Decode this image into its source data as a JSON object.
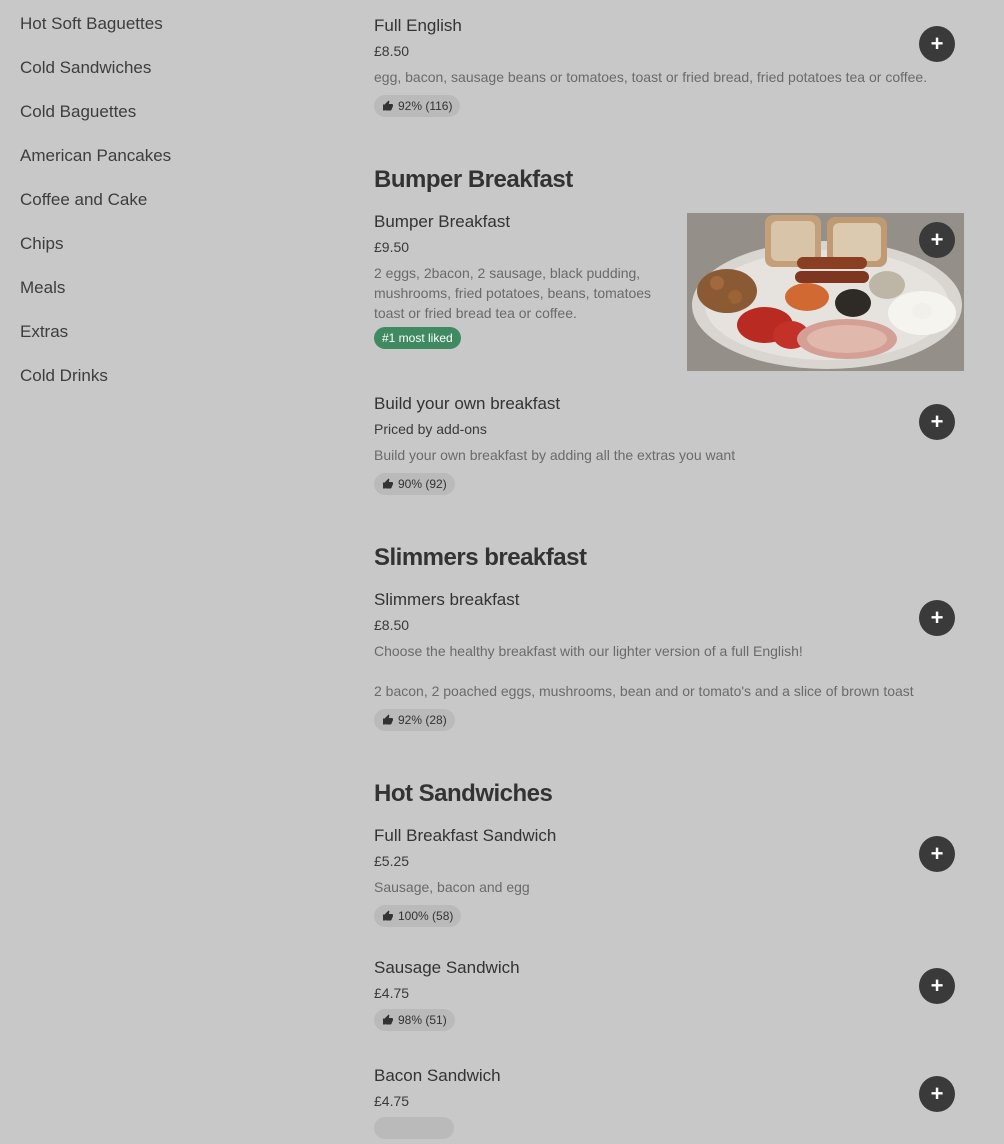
{
  "sidebar": {
    "items": [
      {
        "label": "Hot Soft Baguettes"
      },
      {
        "label": "Cold Sandwiches"
      },
      {
        "label": "Cold Baguettes"
      },
      {
        "label": "American Pancakes"
      },
      {
        "label": "Coffee and Cake"
      },
      {
        "label": "Chips"
      },
      {
        "label": "Meals"
      },
      {
        "label": "Extras"
      },
      {
        "label": "Cold Drinks"
      }
    ]
  },
  "sections": {
    "bumper": {
      "title": "Bumper Breakfast"
    },
    "slimmers": {
      "title": "Slimmers breakfast"
    },
    "hot_sandwiches": {
      "title": "Hot Sandwiches"
    }
  },
  "items": {
    "full_english": {
      "name": "Full English",
      "price": "£8.50",
      "description": "egg, bacon, sausage beans or tomatoes, toast or fried bread, fried potatoes tea or coffee.",
      "rating": "92% (116)"
    },
    "bumper_breakfast": {
      "name": "Bumper Breakfast",
      "price": "£9.50",
      "description": "2 eggs, 2bacon, 2 sausage, black pudding, mushrooms, fried potatoes, beans, tomatoes toast or fried bread tea or coffee.",
      "badge": "#1 most liked"
    },
    "build_your_own": {
      "name": "Build your own breakfast",
      "price": "Priced by add-ons",
      "description": "Build your own breakfast by adding all the extras you want",
      "rating": "90% (92)"
    },
    "slimmers_breakfast": {
      "name": "Slimmers breakfast",
      "price": "£8.50",
      "description": "Choose the healthy breakfast with our lighter version of a full English!",
      "description2": "2 bacon, 2 poached eggs, mushrooms, bean and or tomato's and a slice of brown toast",
      "rating": "92% (28)"
    },
    "full_breakfast_sandwich": {
      "name": "Full Breakfast Sandwich",
      "price": "£5.25",
      "description": "Sausage, bacon and egg",
      "rating": "100% (58)"
    },
    "sausage_sandwich": {
      "name": "Sausage Sandwich",
      "price": "£4.75",
      "rating": "98% (51)"
    },
    "bacon_sandwich": {
      "name": "Bacon Sandwich",
      "price": "£4.75"
    }
  },
  "buttons": {
    "add_label": "+"
  },
  "colors": {
    "background": "#c8c8c8",
    "add_button": "#3a3a3a",
    "most_liked_badge": "#3f8a61"
  }
}
